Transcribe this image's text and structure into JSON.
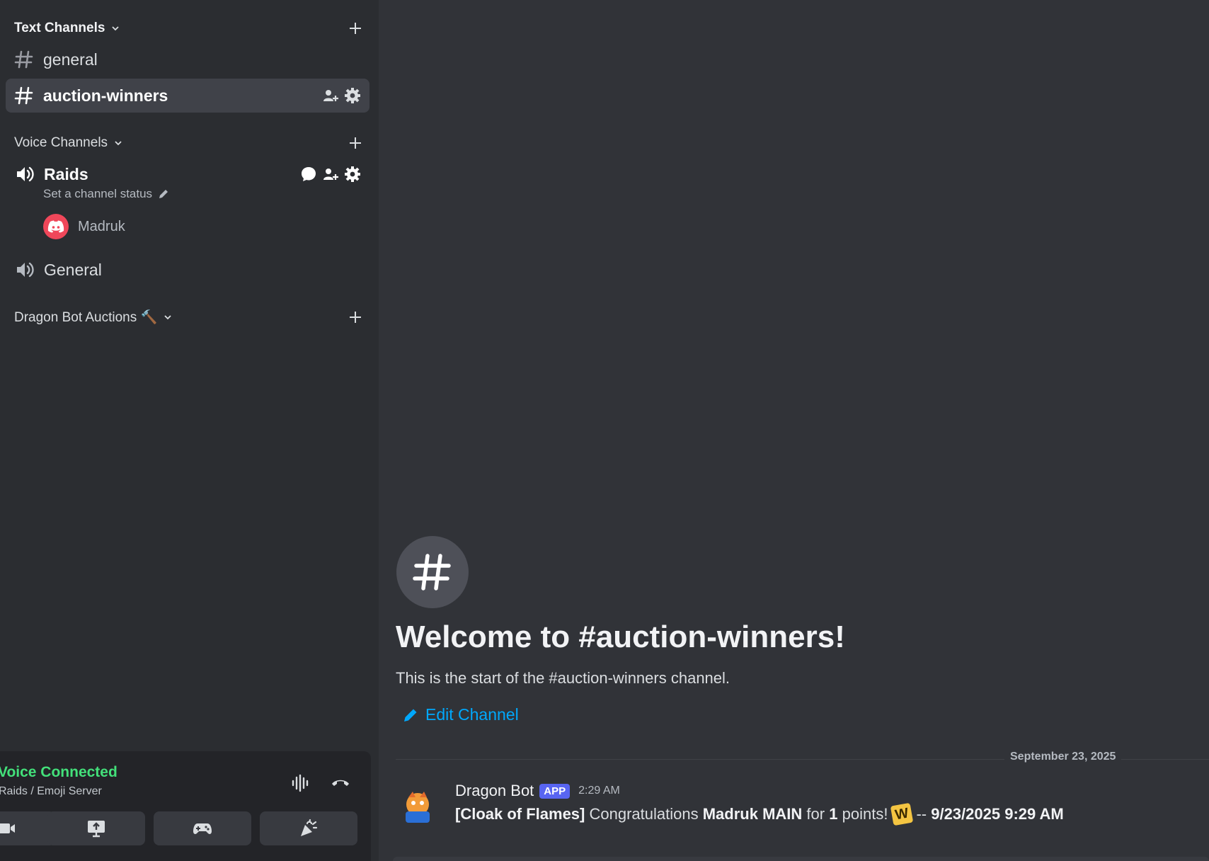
{
  "sidebar": {
    "text_category": {
      "label": "Text Channels"
    },
    "text_channels": [
      {
        "name": "general"
      },
      {
        "name": "auction-winners"
      }
    ],
    "voice_category": {
      "label": "Voice Channels"
    },
    "voice_channels": [
      {
        "name": "Raids",
        "status_prompt": "Set a channel status",
        "members": [
          {
            "name": "Madruk"
          }
        ]
      },
      {
        "name": "General"
      }
    ],
    "auction_category": {
      "label": "Dragon Bot Auctions 🔨"
    }
  },
  "voice_panel": {
    "title": "Voice Connected",
    "subtitle": "Raids / Emoji Server"
  },
  "main": {
    "welcome_title": "Welcome to #auction-winners!",
    "welcome_sub": "This is the start of the #auction-winners channel.",
    "edit_channel": "Edit Channel",
    "date_divider": "September 23, 2025",
    "message": {
      "author": "Dragon Bot",
      "badge": "APP",
      "time": "2:29 AM",
      "item": "[Cloak of Flames]",
      "text1": "Congratulations",
      "winner": "Madruk MAIN",
      "text2": "for",
      "points": "1",
      "text3": "points!",
      "text4": "--",
      "datetime": "9/23/2025  9:29 AM"
    }
  },
  "colors": {
    "accent_link": "#00a8fc",
    "voice_connected": "#43e07a",
    "app_badge": "#5865f2",
    "member_avatar": "#f0475a"
  }
}
